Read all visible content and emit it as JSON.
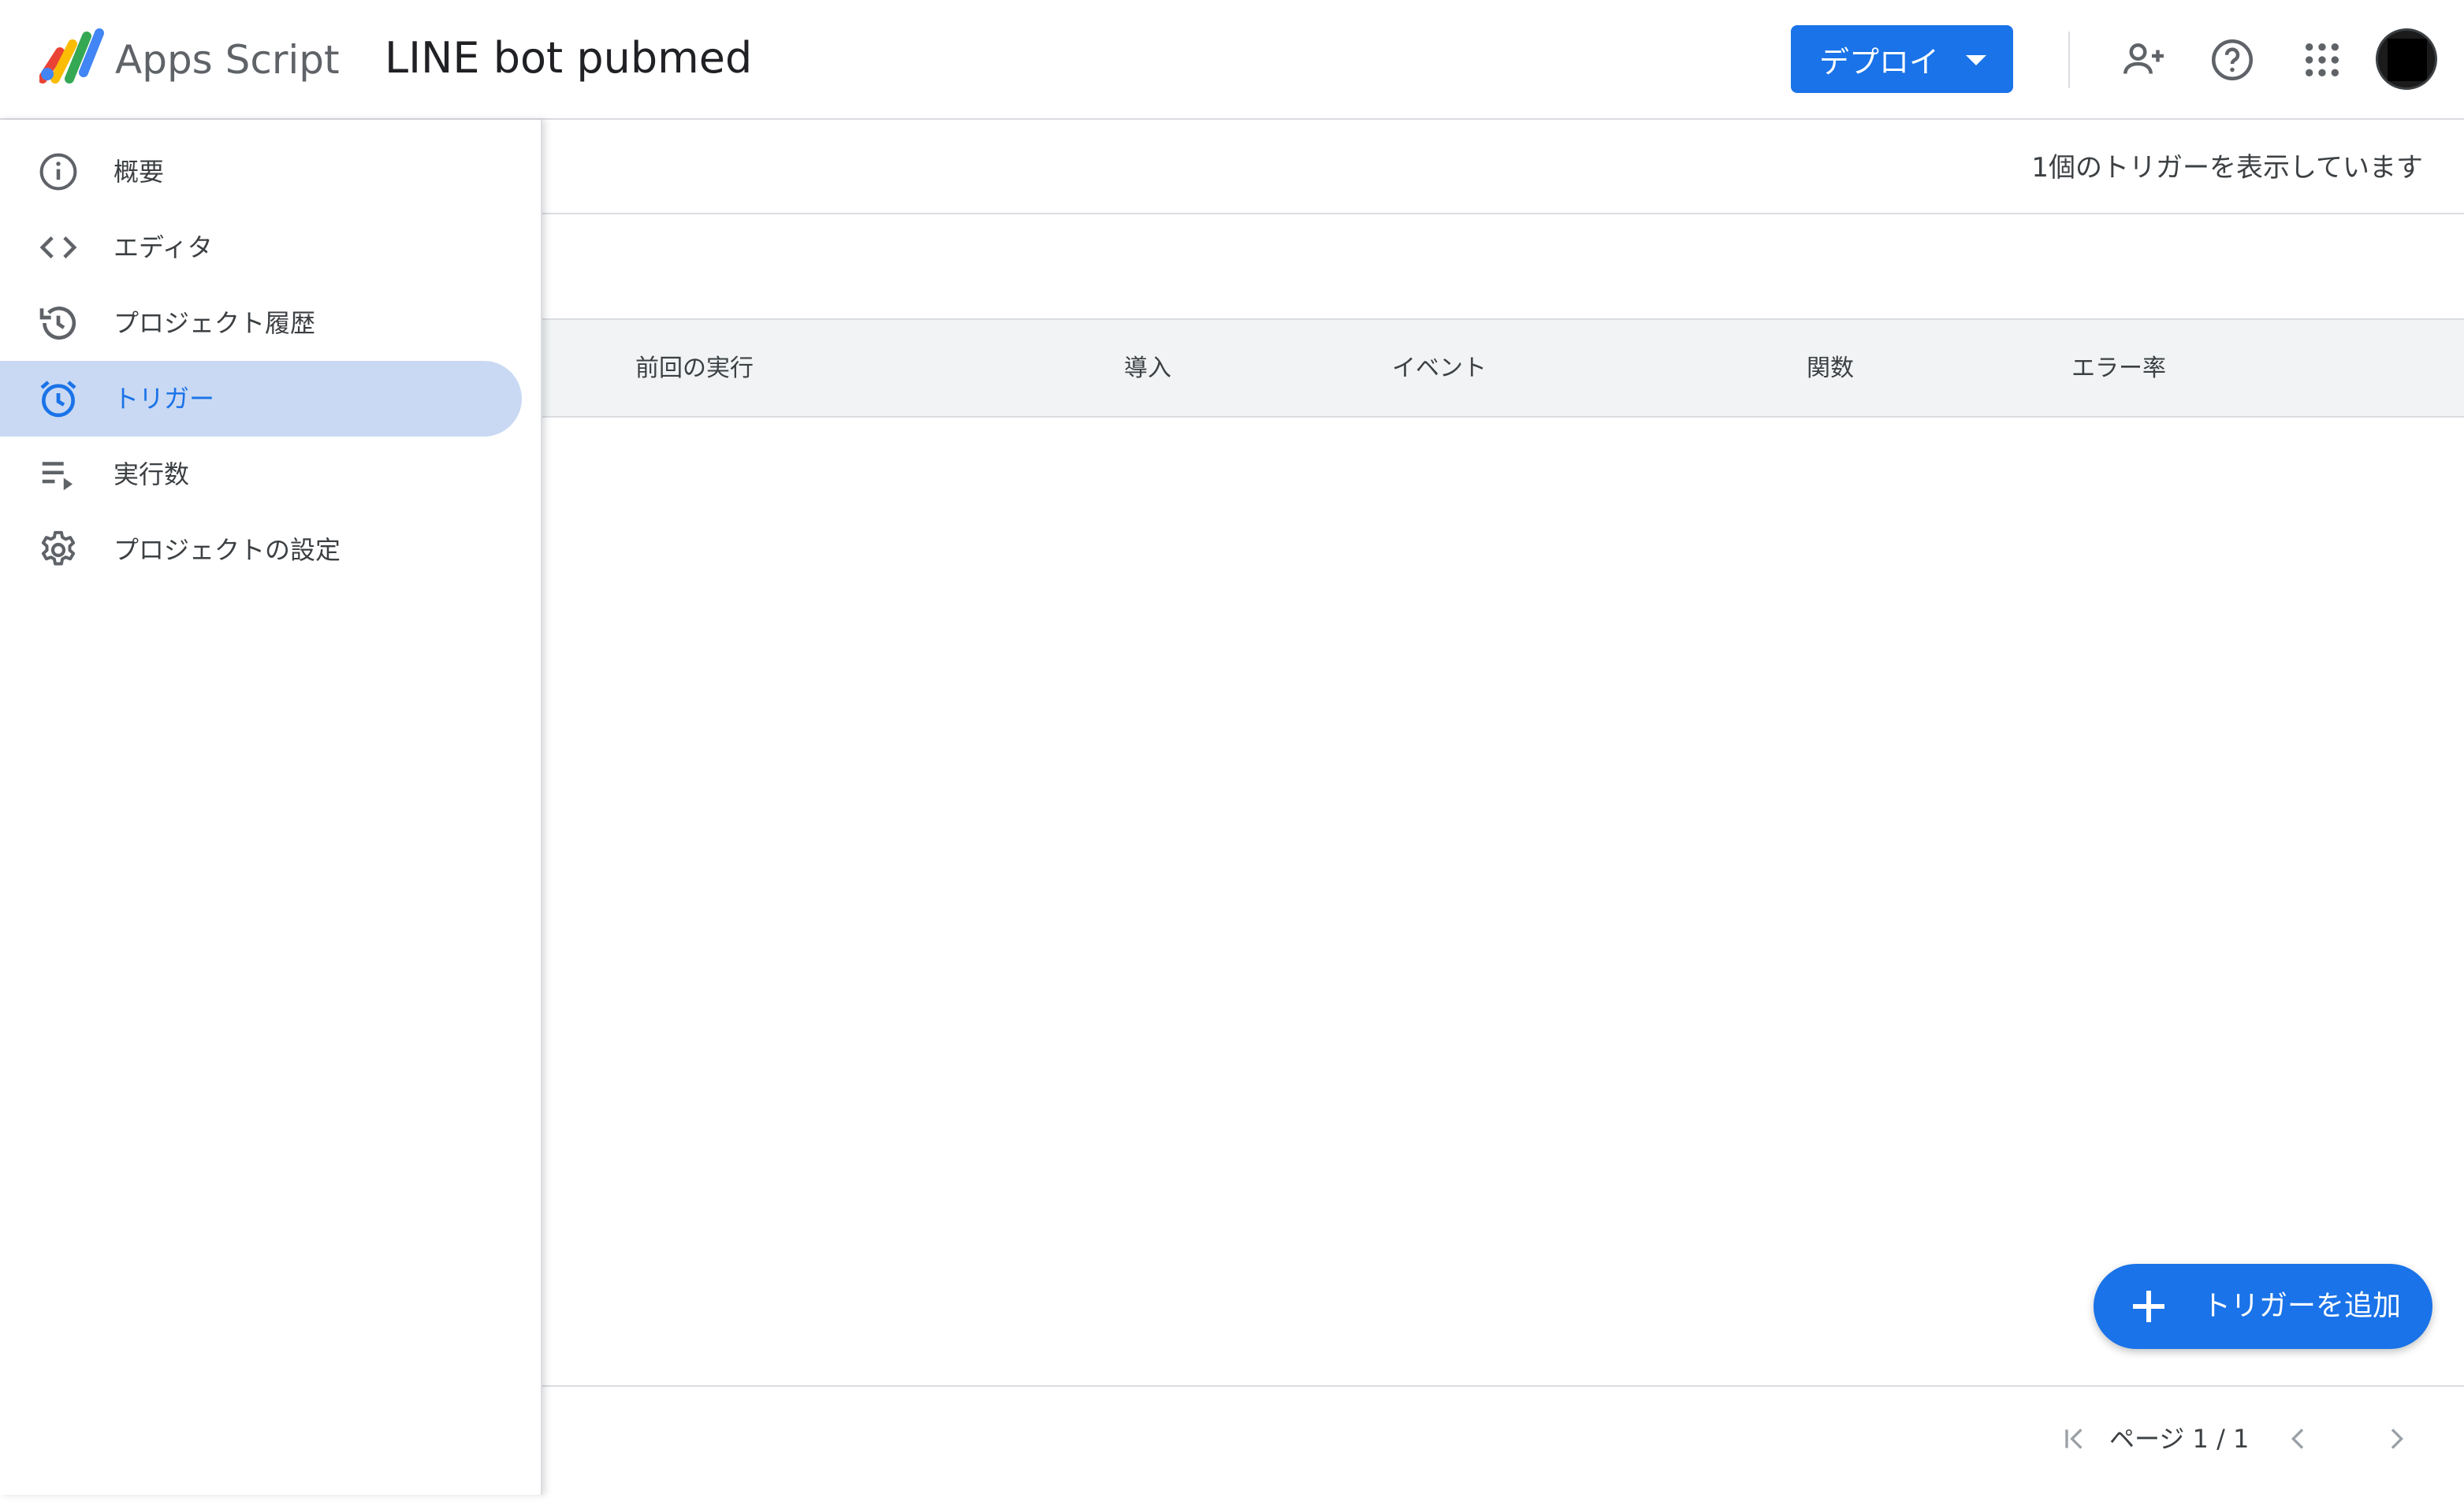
{
  "header": {
    "product_name": "Apps Script",
    "project_title": "LINE bot pubmed",
    "deploy_label": "デプロイ",
    "icons": [
      "apps-script-logo",
      "add-person-icon",
      "help-icon",
      "apps-grid-icon",
      "avatar"
    ]
  },
  "sidebar": {
    "items": [
      {
        "label": "概要",
        "icon": "info-icon",
        "active": false
      },
      {
        "label": "エディタ",
        "icon": "code-icon",
        "active": false
      },
      {
        "label": "プロジェクト履歴",
        "icon": "history-icon",
        "active": false
      },
      {
        "label": "トリガー",
        "icon": "alarm-icon",
        "active": true
      },
      {
        "label": "実行数",
        "icon": "executions-icon",
        "active": false
      },
      {
        "label": "プロジェクトの設定",
        "icon": "gear-icon",
        "active": false
      }
    ]
  },
  "main": {
    "trigger_count_text": "1個のトリガーを表示しています",
    "columns": [
      "前回の実行",
      "導入",
      "イベント",
      "関数",
      "エラー率"
    ],
    "rows": [],
    "add_trigger_label": "トリガーを追加",
    "pagination": {
      "text": "ページ 1 / 1"
    }
  },
  "colors": {
    "accent": "#1a73e8",
    "active_nav_bg": "#c9d9f3",
    "table_header_bg": "#f1f3f4",
    "divider": "#dadce0"
  }
}
